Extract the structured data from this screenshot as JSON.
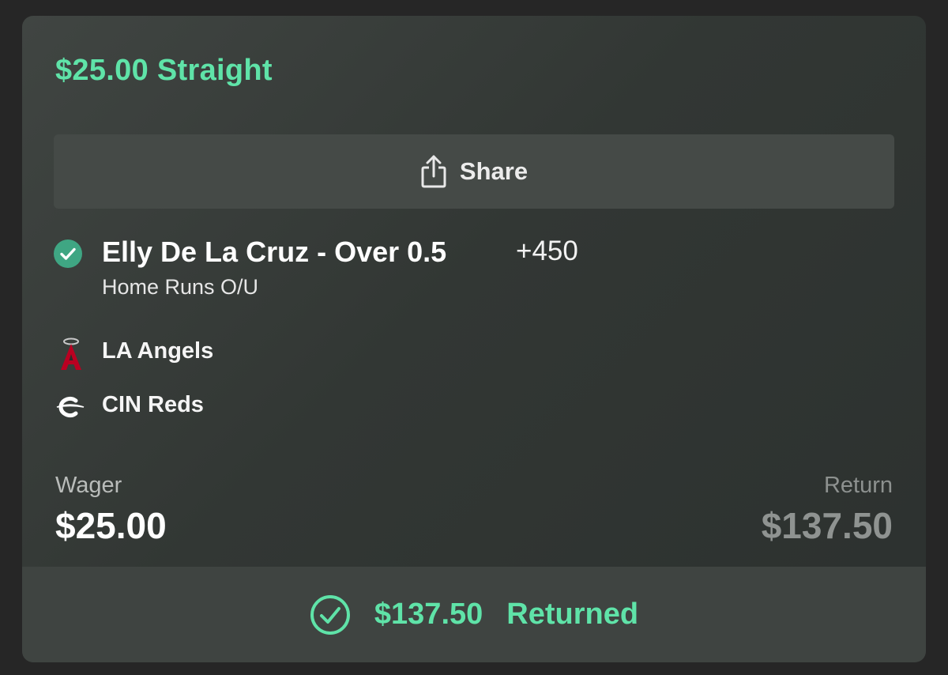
{
  "bet": {
    "title": "$25.00 Straight"
  },
  "share": {
    "label": "Share",
    "icon": "share-icon"
  },
  "pick": {
    "status_icon": "check-circle-icon",
    "selection": "Elly De La Cruz - Over 0.5",
    "odds": "+450",
    "market": "Home Runs O/U"
  },
  "teams": [
    {
      "name": "LA Angels",
      "logo": "angels-logo"
    },
    {
      "name": "CIN Reds",
      "logo": "reds-logo"
    }
  ],
  "wager": {
    "label": "Wager",
    "value": "$25.00"
  },
  "return": {
    "label": "Return",
    "value": "$137.50"
  },
  "result": {
    "icon": "check-circle-outline-icon",
    "amount": "$137.50",
    "label": "Returned"
  },
  "colors": {
    "accent_green": "#5fe3a8",
    "card_background": "#353a37",
    "pick_check": "#3fa683"
  }
}
